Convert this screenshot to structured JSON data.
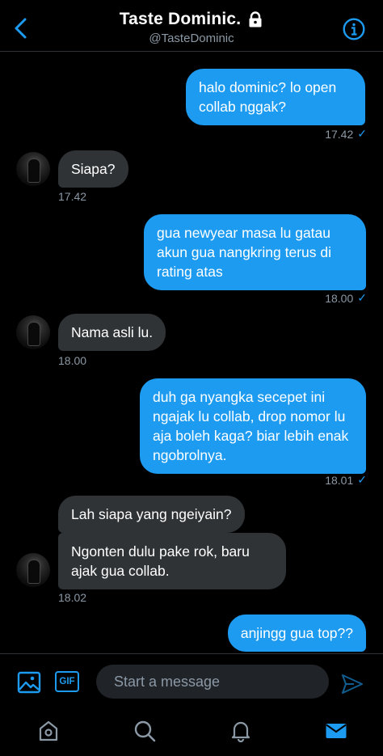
{
  "header": {
    "title": "Taste Dominic.",
    "handle": "@TasteDominic"
  },
  "messages": [
    {
      "dir": "out",
      "text": "halo dominic? lo open collab nggak?",
      "time": "17.42",
      "read": true
    },
    {
      "dir": "in",
      "text": "Siapa?",
      "time": "17.42"
    },
    {
      "dir": "out",
      "text": "gua newyear masa lu gatau akun gua nangkring terus di rating atas",
      "time": "18.00",
      "read": true
    },
    {
      "dir": "in",
      "text": "Nama asli lu.",
      "time": "18.00"
    },
    {
      "dir": "out",
      "text": "duh ga nyangka secepet ini ngajak lu collab, drop nomor lu aja boleh kaga? biar lebih enak ngobrolnya.",
      "time": "18.01",
      "read": true
    },
    {
      "dir": "in",
      "text": "Lah siapa yang ngeiyain?"
    },
    {
      "dir": "in",
      "text": "Ngonten dulu pake rok, baru ajak gua collab.",
      "time": "18.02"
    },
    {
      "dir": "out",
      "text": "anjingg gua top??"
    }
  ],
  "composer": {
    "gif_label": "GIF",
    "placeholder": "Start a message"
  },
  "colors": {
    "accent": "#1d9bf0",
    "incoming_bubble": "#2f3336",
    "muted_text": "#8b98a5",
    "background": "#000000"
  },
  "icons": {
    "back": "chevron-left-icon",
    "lock": "lock-icon",
    "info": "info-icon",
    "image": "image-icon",
    "gif": "gif-icon",
    "send": "send-icon",
    "home": "home-icon",
    "search": "search-icon",
    "notifications": "bell-icon",
    "messages": "mail-icon"
  }
}
